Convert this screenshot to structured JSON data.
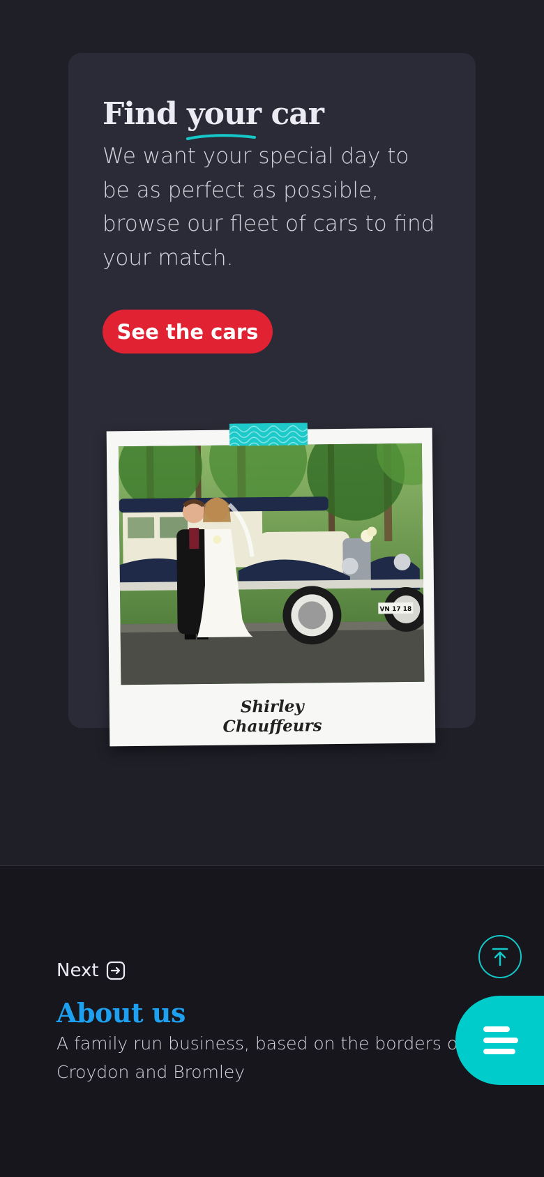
{
  "card": {
    "title_before": "Find ",
    "title_highlight": "your",
    "title_after": " car",
    "description": "We want your special day to be as perfect as possible, browse our fleet of cars to find your match.",
    "cta_label": "See the cars"
  },
  "polaroid": {
    "caption_line1": "Shirley",
    "caption_line2": "Chauffeurs",
    "plate_text": "VN 17 18"
  },
  "next": {
    "label": "Next",
    "title": "About us",
    "description": "A family run business, based on the borders of Croydon and Bromley"
  },
  "icons": {
    "next": "arrow-right-box-icon",
    "scroll_top": "arrow-up-circle-icon",
    "menu": "hamburger-menu-icon"
  },
  "colors": {
    "accent_teal": "#00cccc",
    "cta_red": "#e02233",
    "link_blue": "#1ea0f0",
    "card_bg": "#2b2b37",
    "page_bg": "#1f1f28"
  }
}
